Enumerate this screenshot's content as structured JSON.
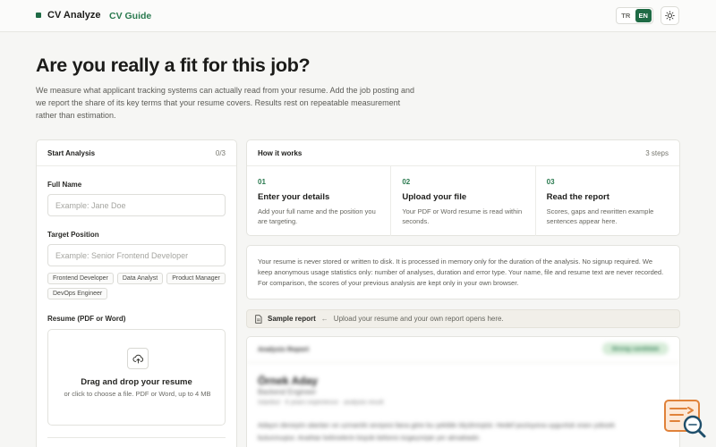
{
  "header": {
    "brand": "CV Analyze",
    "nav_link": "CV Guide",
    "lang_options": [
      "TR",
      "EN"
    ],
    "lang_active": "EN",
    "theme_icon": "sun-icon"
  },
  "hero": {
    "title": "Are you really a fit for this job?",
    "description": "We measure what applicant tracking systems can actually read from your resume. Add the job posting and we report the share of its key terms that your resume covers. Results rest on repeatable measurement rather than estimation."
  },
  "form": {
    "title": "Start Analysis",
    "counter": "0/3",
    "full_name_label": "Full Name",
    "full_name_placeholder": "Example: Jane Doe",
    "position_label": "Target Position",
    "position_placeholder": "Example: Senior Frontend Developer",
    "position_suggestions": [
      "Frontend Developer",
      "Data Analyst",
      "Product Manager",
      "DevOps Engineer"
    ],
    "resume_label": "Resume (PDF or Word)",
    "drop_title": "Drag and drop your resume",
    "drop_sub": "or click to choose a file. PDF or Word, up to 4 MB"
  },
  "how": {
    "title": "How it works",
    "count": "3 steps",
    "steps": [
      {
        "num": "01",
        "title": "Enter your details",
        "desc": "Add your full name and the position you are targeting."
      },
      {
        "num": "02",
        "title": "Upload your file",
        "desc": "Your PDF or Word resume is read within seconds."
      },
      {
        "num": "03",
        "title": "Read the report",
        "desc": "Scores, gaps and rewritten example sentences appear here."
      }
    ]
  },
  "privacy": {
    "text": "Your resume is never stored or written to disk. It is processed in memory only for the duration of the analysis. No signup required. We keep anonymous usage statistics only: number of analyses, duration and error type. Your name, file and resume text are never recorded. For comparison, the scores of your previous analysis are kept only in your own browser."
  },
  "sample": {
    "title": "Sample report",
    "hint": "Upload your resume and your own report opens here."
  },
  "report_preview": {
    "heading": "Analysis Report",
    "badge": "Strong candidate",
    "name": "Örnek Aday",
    "role": "Backend Engineer",
    "meta": "Istanbul · 6 years experience · analysis result",
    "text": "Adayın deneyim alanları ve uzmanlık seviyesi ilana göre bu şekilde ölçülmüştür. Hedef pozisyona uygunluk oranı yüksek bulunmuştur. Anahtar kelimelerin büyük bölümü özgeçmişte yer almaktadır."
  },
  "colors": {
    "accent": "#1f6b45",
    "accent_text": "#2a7a4f",
    "background": "#f6f6f4",
    "assistant_orange": "#e0823a"
  }
}
